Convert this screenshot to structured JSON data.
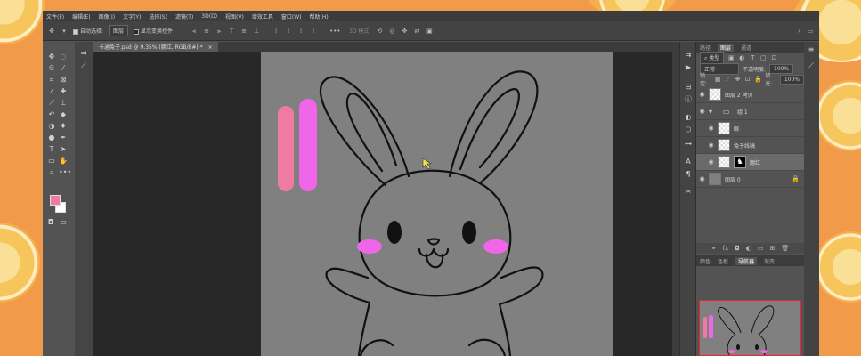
{
  "menu": [
    "文件(F)",
    "编辑(E)",
    "图像(I)",
    "文字(Y)",
    "选择(S)",
    "滤镜(T)",
    "3D(D)",
    "视图(V)",
    "增效工具",
    "窗口(W)",
    "帮助(H)"
  ],
  "options": {
    "auto_select_label": "自动选择:",
    "auto_select_value": "图层",
    "transform_label": "显示变换控件",
    "mode_label": "3D 模式:"
  },
  "document_tab": "卡通兔子.psd @ 9.35% (腮红, RGB/8#) *",
  "panels": {
    "tabs_top": [
      "路径",
      "图层",
      "通道"
    ],
    "active_top": "图层",
    "kind_filter": "类型",
    "blend_mode": "正常",
    "opacity_label": "不透明度:",
    "opacity_value": "100%",
    "lock_label": "锁定:",
    "fill_label": "填充:",
    "fill_value": "100%",
    "layers": [
      {
        "name": "图层 2 拷贝",
        "type": "pixel",
        "selected": false,
        "locked": false,
        "indent": 0
      },
      {
        "name": "组 1",
        "type": "group",
        "selected": false,
        "locked": false,
        "indent": 0
      },
      {
        "name": "眼",
        "type": "pixel",
        "selected": false,
        "locked": false,
        "indent": 1
      },
      {
        "name": "兔子线稿",
        "type": "pixel",
        "selected": false,
        "locked": false,
        "indent": 1
      },
      {
        "name": "腮红",
        "type": "masked",
        "selected": true,
        "locked": false,
        "indent": 1
      },
      {
        "name": "图层 0",
        "type": "gray",
        "selected": false,
        "locked": true,
        "indent": 0
      }
    ],
    "tabs_bottom": [
      "颜色",
      "色板",
      "导航器",
      "渐变"
    ],
    "active_bottom": "导航器"
  },
  "colors": {
    "foreground": "#f07ba0",
    "background": "#ffffff",
    "desktop": "#f19a4a",
    "stroke_pink": "#f07ba0",
    "stroke_magenta": "#f066e8"
  },
  "icons": [
    "move-icon",
    "marquee-icon",
    "lasso-icon",
    "magic-wand-icon",
    "crop-icon",
    "frame-icon",
    "eyedropper-icon",
    "heal-icon",
    "brush-icon",
    "stamp-icon",
    "history-brush-icon",
    "eraser-icon",
    "gradient-icon",
    "blur-icon",
    "dodge-icon",
    "pen-icon",
    "type-icon",
    "path-select-icon",
    "rectangle-icon",
    "hand-icon",
    "zoom-icon",
    "more-icon"
  ]
}
